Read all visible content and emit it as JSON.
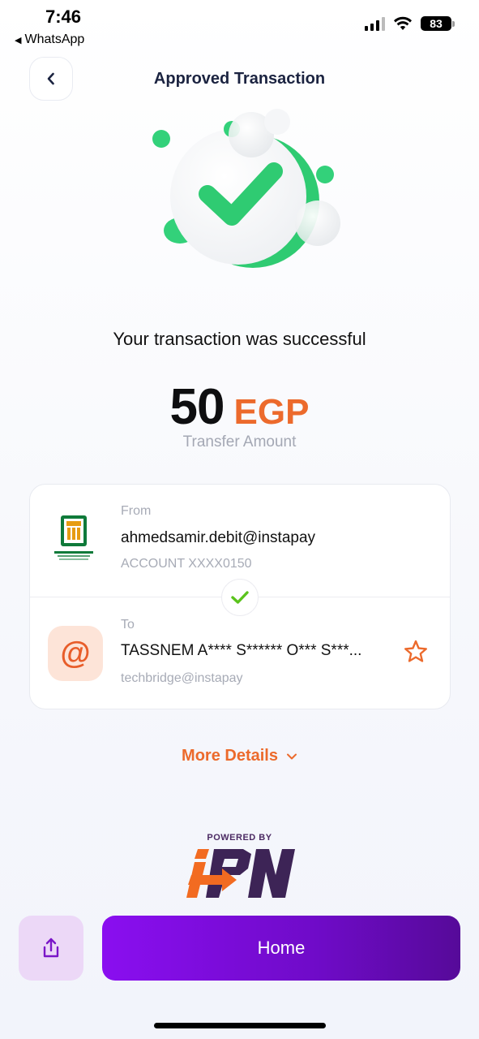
{
  "status_bar": {
    "time": "7:46",
    "back_app": "WhatsApp",
    "battery": "83"
  },
  "header": {
    "title": "Approved Transaction",
    "back_icon": "chevron-left-icon"
  },
  "result": {
    "message": "Your transaction was successful",
    "amount": "50",
    "currency": "EGP",
    "amount_label": "Transfer Amount"
  },
  "transfer": {
    "from": {
      "label": "From",
      "address": "ahmedsamir.debit@instapay",
      "account": "ACCOUNT  XXXX0150"
    },
    "to": {
      "label": "To",
      "name": "TASSNEM A**** S****** O*** S***...",
      "address": "techbridge@instapay",
      "avatar_symbol": "@"
    }
  },
  "more_details": {
    "label": "More Details"
  },
  "footer": {
    "powered_by": "POWERED BY",
    "home_label": "Home"
  },
  "colors": {
    "accent_orange": "#ec6a2c",
    "primary_purple": "#7a0cd8",
    "success_green": "#33d17a"
  }
}
